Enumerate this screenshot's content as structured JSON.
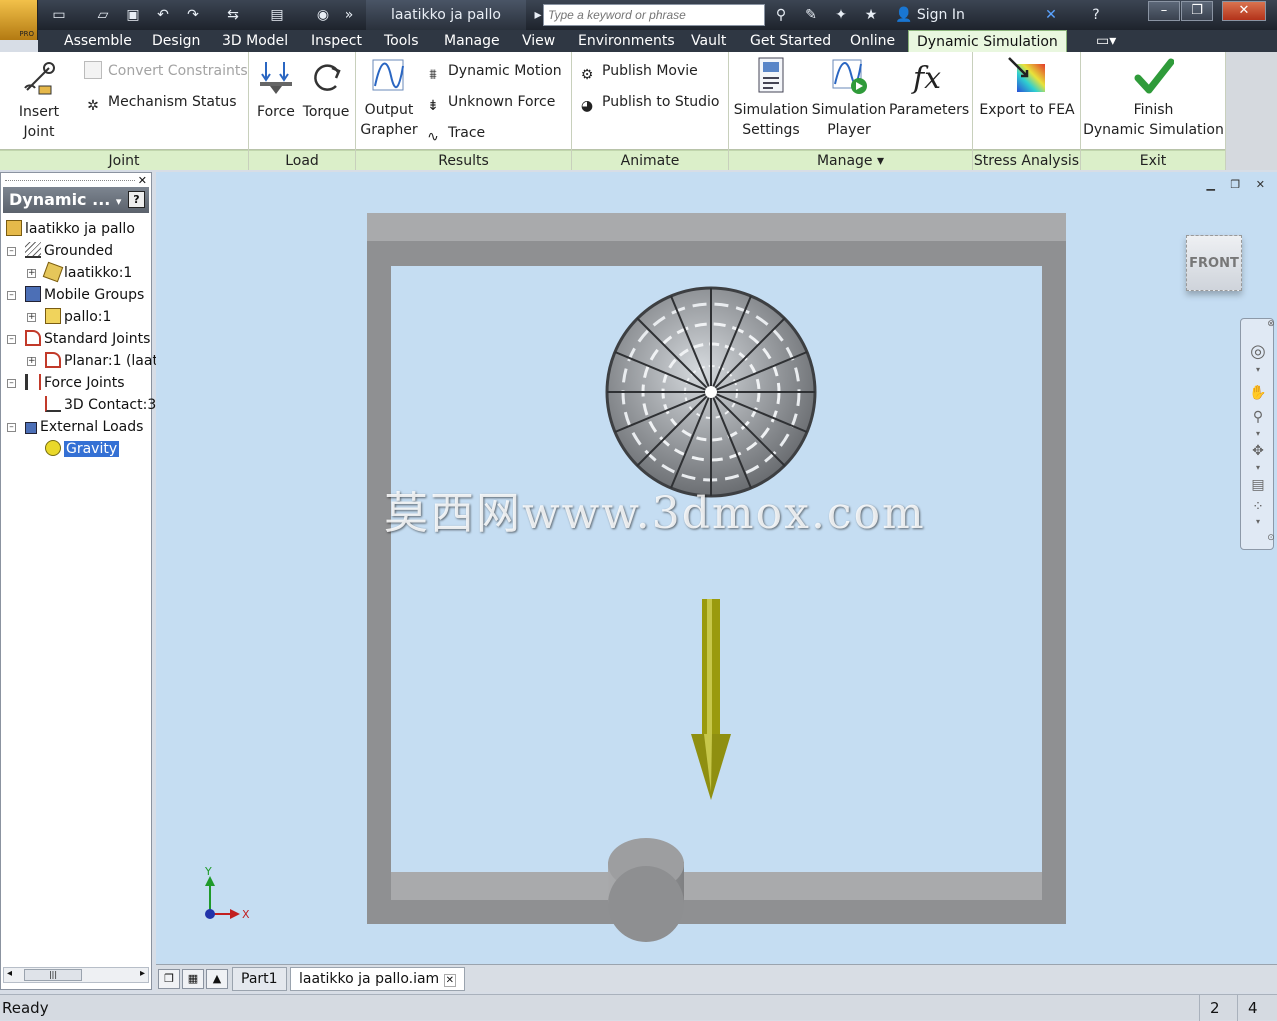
{
  "app": {
    "doc_title": "laatikko ja pallo",
    "badge": "PRO"
  },
  "search": {
    "placeholder": "Type a keyword or phrase"
  },
  "account": {
    "sign_in": "Sign In"
  },
  "tabs": [
    {
      "label": "Assemble"
    },
    {
      "label": "Design"
    },
    {
      "label": "3D Model"
    },
    {
      "label": "Inspect"
    },
    {
      "label": "Tools"
    },
    {
      "label": "Manage"
    },
    {
      "label": "View"
    },
    {
      "label": "Environments"
    },
    {
      "label": "Vault"
    },
    {
      "label": "Get Started"
    },
    {
      "label": "Online"
    },
    {
      "label": "Dynamic Simulation"
    }
  ],
  "ribbon": {
    "joint": {
      "label": "Joint",
      "insert_joint": "Insert Joint",
      "convert_constraints": "Convert Constraints",
      "mechanism_status": "Mechanism Status"
    },
    "load": {
      "label": "Load",
      "force": "Force",
      "torque": "Torque"
    },
    "results": {
      "label": "Results",
      "output_grapher_1": "Output",
      "output_grapher_2": "Grapher",
      "dynamic_motion": "Dynamic Motion",
      "unknown_force": "Unknown Force",
      "trace": "Trace"
    },
    "animate": {
      "label": "Animate",
      "publish_movie": "Publish Movie",
      "publish_studio": "Publish to Studio"
    },
    "manage": {
      "label": "Manage",
      "sim_settings_1": "Simulation",
      "sim_settings_2": "Settings",
      "sim_player_1": "Simulation",
      "sim_player_2": "Player",
      "parameters": "Parameters"
    },
    "stress": {
      "label": "Stress Analysis",
      "export_fea": "Export to FEA"
    },
    "exit": {
      "label": "Exit",
      "finish_1": "Finish",
      "finish_2": "Dynamic Simulation"
    }
  },
  "browser": {
    "title": "Dynamic ...",
    "items": [
      {
        "label": "laatikko ja pallo"
      },
      {
        "label": "Grounded"
      },
      {
        "label": "laatikko:1"
      },
      {
        "label": "Mobile Groups"
      },
      {
        "label": "pallo:1"
      },
      {
        "label": "Standard Joints"
      },
      {
        "label": "Planar:1 (laat"
      },
      {
        "label": "Force Joints"
      },
      {
        "label": "3D Contact:3"
      },
      {
        "label": "External Loads"
      },
      {
        "label": "Gravity"
      }
    ]
  },
  "viewport": {
    "viewcube": "FRONT",
    "watermark": "莫西网www.3dmox.com",
    "axis_x": "X",
    "axis_y": "Y",
    "colors": {
      "background": "#c5ddf2",
      "box": "#8f9092",
      "gravity_arrow": "#9a9a0e"
    }
  },
  "doc_tabs": [
    {
      "label": "Part1"
    },
    {
      "label": "laatikko ja pallo.iam"
    }
  ],
  "status": {
    "text": "Ready",
    "cell1": "2",
    "cell2": "4"
  }
}
